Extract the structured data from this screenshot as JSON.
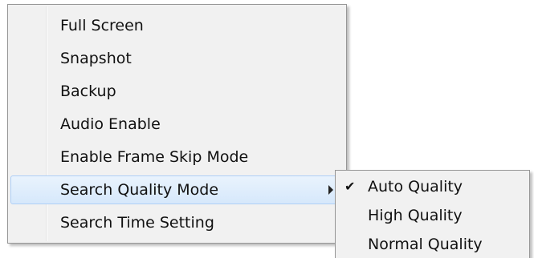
{
  "context_menu": {
    "items": [
      {
        "label": "Full Screen"
      },
      {
        "label": "Snapshot"
      },
      {
        "label": "Backup"
      },
      {
        "label": "Audio Enable"
      },
      {
        "label": "Enable Frame Skip Mode"
      },
      {
        "label": "Search Quality Mode",
        "has_submenu": true,
        "highlighted": true
      },
      {
        "label": "Search Time Setting"
      }
    ]
  },
  "submenu": {
    "items": [
      {
        "label": "Auto Quality",
        "checked": true,
        "check_glyph": "✔"
      },
      {
        "label": "High Quality",
        "checked": false
      },
      {
        "label": "Normal Quality",
        "checked": false
      }
    ]
  },
  "colors": {
    "menu_background": "#f1f1f1",
    "highlight_background": "#dbeafc",
    "highlight_border": "#aecff7",
    "menu_border": "#979797"
  }
}
